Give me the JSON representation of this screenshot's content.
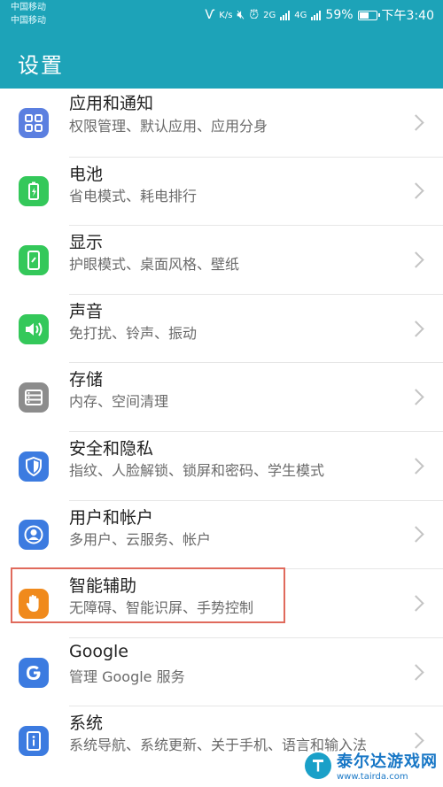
{
  "status_bar": {
    "carrier_1": "中国移动",
    "carrier_2": "中国移动",
    "speed": "K/s",
    "net_1": "2G",
    "net_2": "4G",
    "battery_percent": "59%",
    "battery_level": 0.59,
    "time": "下午3:40"
  },
  "header": {
    "title": "设置"
  },
  "settings_items": [
    {
      "title": "应用和通知",
      "subtitle": "权限管理、默认应用、应用分身",
      "icon": "apps-grid-icon",
      "color": "#5b7fe0"
    },
    {
      "title": "电池",
      "subtitle": "省电模式、耗电排行",
      "icon": "battery-icon",
      "color": "#34c85a"
    },
    {
      "title": "显示",
      "subtitle": "护眼模式、桌面风格、壁纸",
      "icon": "display-icon",
      "color": "#34c85a"
    },
    {
      "title": "声音",
      "subtitle": "免打扰、铃声、振动",
      "icon": "sound-icon",
      "color": "#34c85a"
    },
    {
      "title": "存储",
      "subtitle": "内存、空间清理",
      "icon": "storage-icon",
      "color": "#8c8c8c"
    },
    {
      "title": "安全和隐私",
      "subtitle": "指纹、人脸解锁、锁屏和密码、学生模式",
      "icon": "shield-icon",
      "color": "#3c7be0"
    },
    {
      "title": "用户和帐户",
      "subtitle": "多用户、云服务、帐户",
      "icon": "user-icon",
      "color": "#3c7be0"
    },
    {
      "title": "智能辅助",
      "subtitle": "无障碍、智能识屏、手势控制",
      "icon": "hand-icon",
      "color": "#f08a1c"
    },
    {
      "title": "Google",
      "subtitle": "管理 Google 服务",
      "icon": "google-icon",
      "color": "#3c7be0"
    },
    {
      "title": "系统",
      "subtitle": "系统导航、系统更新、关于手机、语言和输入法",
      "icon": "system-info-icon",
      "color": "#3c7be0"
    }
  ],
  "watermark": {
    "name": "泰尔达游戏网",
    "url": "www.tairda.com"
  }
}
